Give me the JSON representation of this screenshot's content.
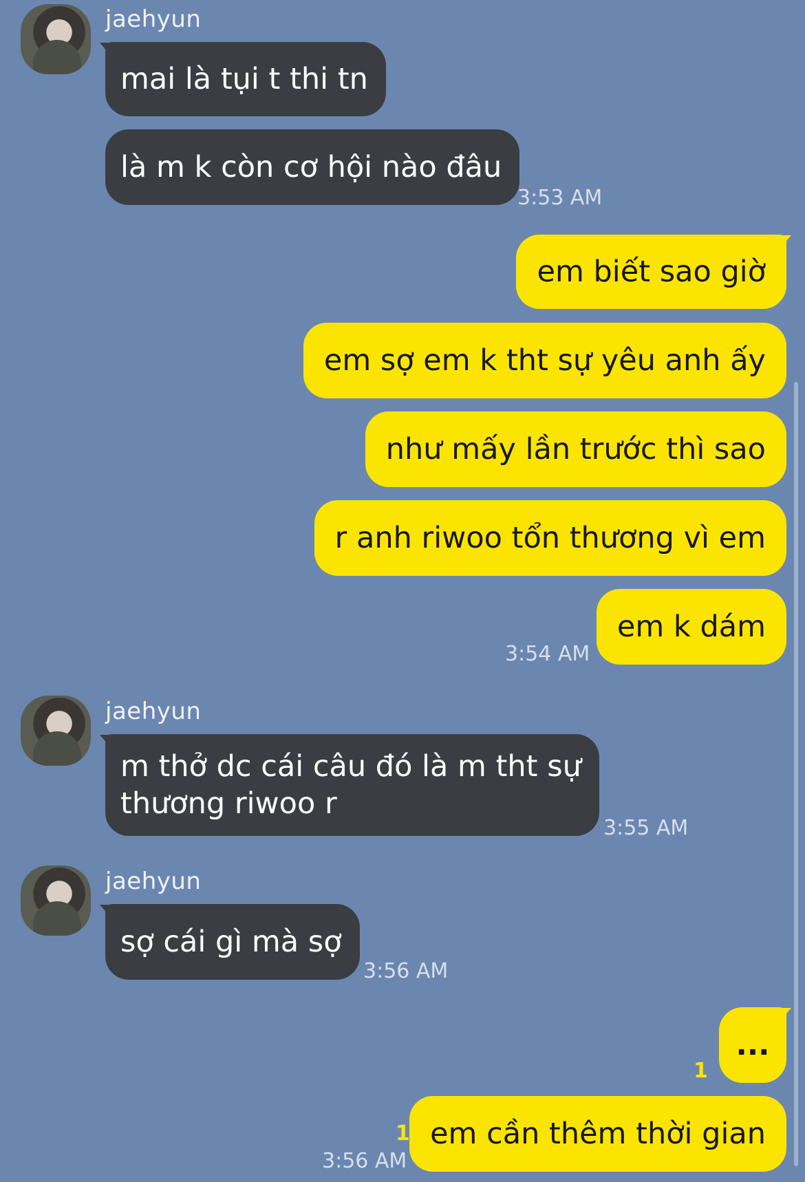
{
  "sender": "jaehyun",
  "messages": [
    {
      "text": "mai là tụi t thi tn"
    },
    {
      "text": "là m k còn cơ hội nào đâu",
      "time": "3:53 AM"
    },
    {
      "text": "em biết sao giờ"
    },
    {
      "text": "em sợ em k tht sự yêu anh ấy"
    },
    {
      "text": "như mấy lần trước thì sao"
    },
    {
      "text": "r anh riwoo tổn thương vì em"
    },
    {
      "text": "em k dám",
      "time": "3:54 AM"
    },
    {
      "line1": "m thở dc cái câu đó là m tht sự",
      "line2": "thương riwoo r",
      "time": "3:55 AM"
    },
    {
      "text": "sợ cái gì mà sợ",
      "time": "3:56 AM"
    },
    {
      "text": "...",
      "unread": "1"
    },
    {
      "text": "em cần thêm thời gian",
      "unread": "1",
      "time": "3:56 AM"
    }
  ]
}
